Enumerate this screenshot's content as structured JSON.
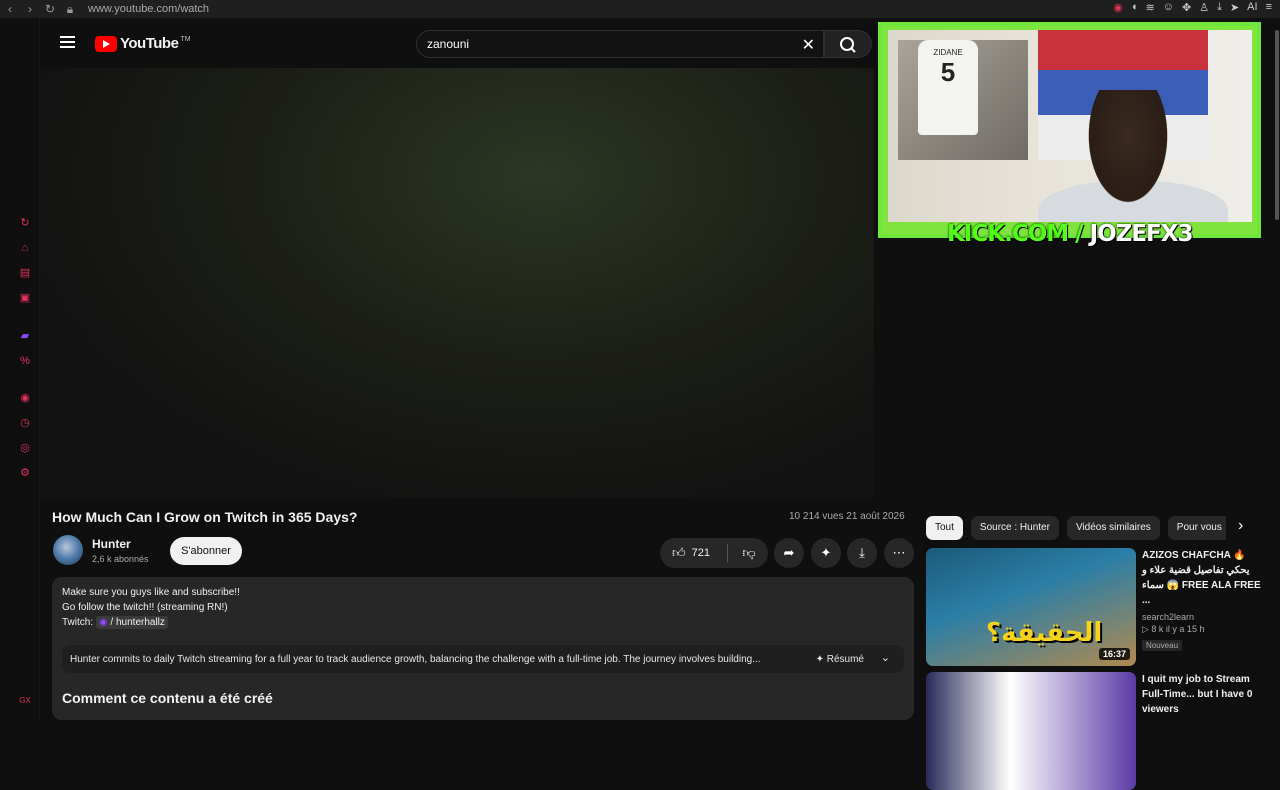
{
  "browser": {
    "url": "www.youtube.com/watch",
    "ai_label": "AI"
  },
  "header": {
    "logo_text": "YouTube",
    "logo_tm": "TM",
    "search_value": "zanouni"
  },
  "overlay": {
    "kick_prefix": "KICK.COM / ",
    "kick_user": "JOZEFX3",
    "jersey_name": "ZIDANE",
    "jersey_number": "5"
  },
  "video": {
    "title": "How Much Can I Grow on Twitch in 365 Days?",
    "views": "10 214 vues  21 août 2026",
    "channel": "Hunter",
    "subscribers": "2,6 k abonnés",
    "subscribe_label": "S'abonner",
    "likes": "721"
  },
  "description": {
    "line1": "Make sure you guys like and subscribe!!",
    "line2": "Go follow the twitch!! (streaming RN!)",
    "twitch_label": "Twitch:",
    "twitch_link": "/ hunterhallz",
    "summary": "Hunter commits to daily Twitch streaming for a full year to track audience growth, balancing the challenge with a full-time job. The journey involves building...",
    "summary_label": "✦ Résumé",
    "section_heading": "Comment ce contenu a été créé"
  },
  "chips": [
    "Tout",
    "Source : Hunter",
    "Vidéos similaires",
    "Pour vous"
  ],
  "recommendations": [
    {
      "title": "AZIZOS CHAFCHA 🔥 يحكي تفاصيل قضية علاء و سماء 😱 FREE ALA FREE ...",
      "channel": "search2learn",
      "meta": "▷ 8 k  il y a 15 h",
      "badge": "Nouveau",
      "duration": "16:37",
      "thumb_text": "الحقيقة؟"
    },
    {
      "title": "I quit my job to Stream Full-Time... but I have 0 viewers",
      "channel": "",
      "meta": "",
      "badge": "",
      "duration": "",
      "thumb_text": ""
    }
  ],
  "colors": {
    "kick_green": "#53fc18",
    "youtube_red": "#ff0000",
    "overlay_border": "#6fe63b"
  }
}
